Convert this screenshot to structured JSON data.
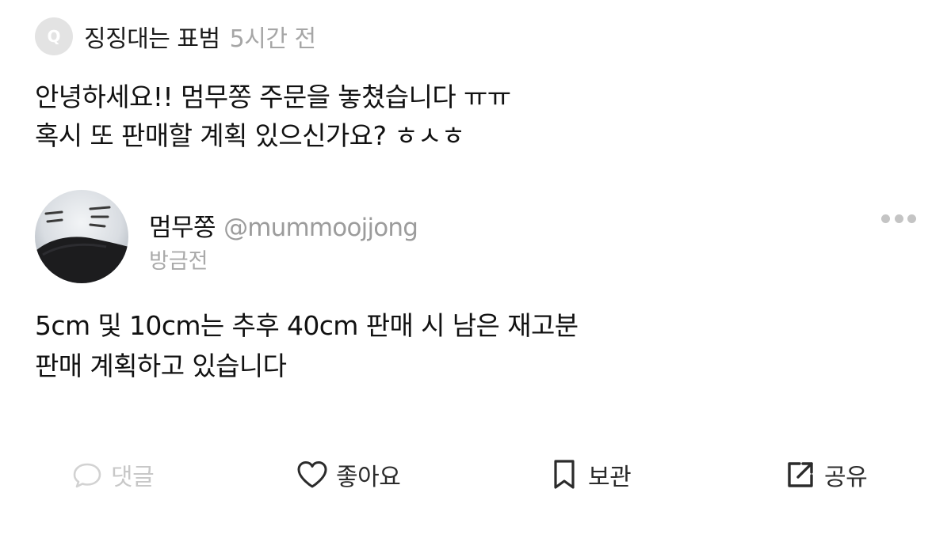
{
  "question": {
    "badge": "Q",
    "author": "징징대는 표범",
    "time": "5시간 전",
    "lines": [
      "안녕하세요!! 멈무쫑 주문을 놓쳤습니다 ㅠㅠ",
      "혹시 또 판매할 계획 있으신가요? ㅎㅅㅎ"
    ]
  },
  "answer": {
    "author_name": "멈무쫑",
    "author_handle": "@mummoojjong",
    "time": "방금전",
    "lines": [
      "5cm 및 10cm는 추후 40cm 판매 시 남은 재고분",
      "판매 계획하고 있습니다"
    ]
  },
  "actions": {
    "comment": "댓글",
    "like": "좋아요",
    "save": "보관",
    "share": "공유"
  },
  "icons": {
    "more": "more-horizontal-icon",
    "comment": "speech-bubble-icon",
    "like": "heart-icon",
    "save": "bookmark-icon",
    "share": "share-arrow-icon"
  },
  "colors": {
    "disabled": "#c8c8c8",
    "muted": "#a6a6a6",
    "text": "#111111"
  }
}
